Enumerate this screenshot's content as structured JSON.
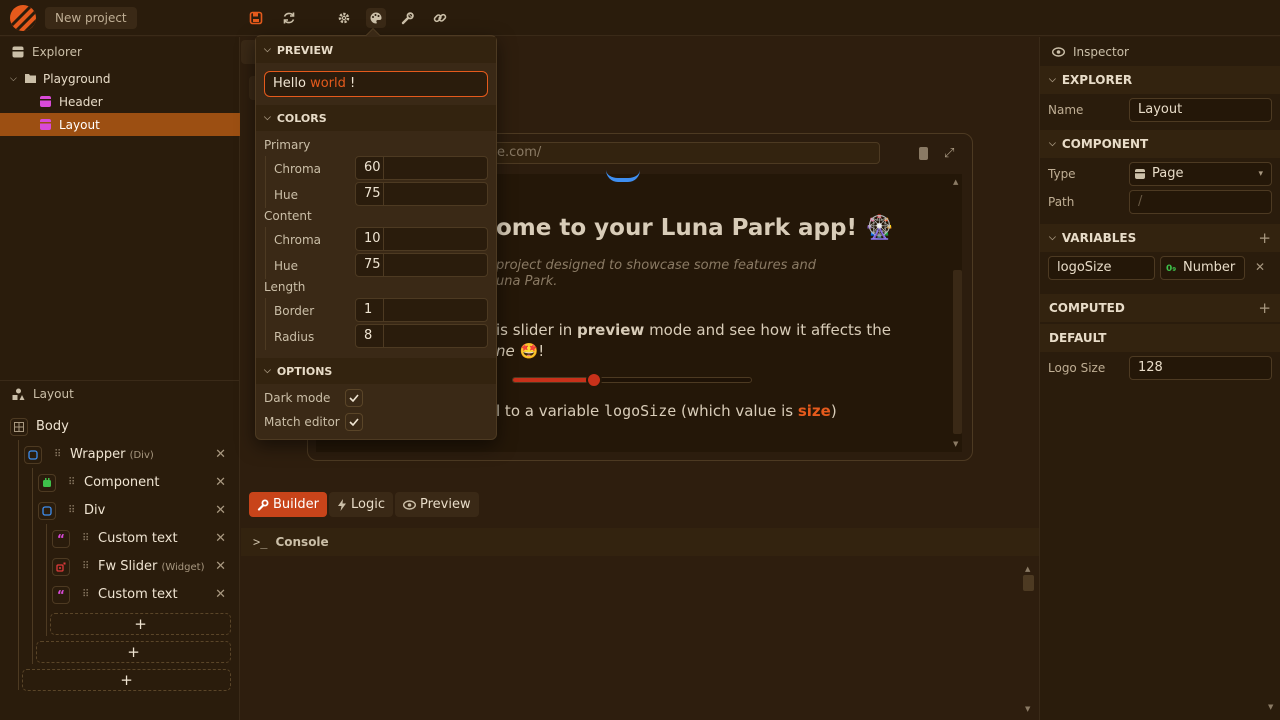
{
  "app": {
    "project_name": "New project"
  },
  "toolbar": {
    "icons": [
      "save-icon",
      "refresh-icon",
      "gear-icon",
      "palette-icon",
      "wrench-icon",
      "link-icon"
    ]
  },
  "explorer": {
    "title": "Explorer",
    "items": [
      {
        "label": "Playground"
      },
      {
        "label": "Header"
      },
      {
        "label": "Layout"
      }
    ]
  },
  "layout_panel": {
    "title": "Layout",
    "body": "Body",
    "wrapper": "Wrapper",
    "wrapper_type": "(Div)",
    "component": "Component",
    "div": "Div",
    "custom_text_1": "Custom text",
    "slider": "Fw Slider",
    "slider_type": "(Widget)",
    "custom_text_2": "Custom text",
    "add": "+"
  },
  "popup": {
    "preview_title": "PREVIEW",
    "preview_hello": "Hello ",
    "preview_world": "world",
    "preview_bang": " !",
    "colors_title": "COLORS",
    "primary_label": "Primary",
    "primary_chroma_label": "Chroma",
    "primary_chroma": "60",
    "primary_hue_label": "Hue",
    "primary_hue": "75",
    "content_label": "Content",
    "content_chroma_label": "Chroma",
    "content_chroma": "10",
    "content_hue_label": "Hue",
    "content_hue": "75",
    "length_label": "Length",
    "border_label": "Border",
    "border": "1",
    "radius_label": "Radius",
    "radius": "8",
    "options_title": "OPTIONS",
    "dark_mode": "Dark mode",
    "match_editor": "Match editor"
  },
  "preview_frame": {
    "url": "e.com/",
    "heading": "ome to your Luna Park app! 🎡",
    "sub1": "project designed to showcase some features and",
    "sub2": "una Park.",
    "p1_a": "is slider in ",
    "p1_b": "preview",
    "p1_c": " mode and see how it affects the",
    "p2_a": "ne ",
    "p2_emoji": "🤩",
    "p2_b": "!",
    "bound_a": "l to a variable ",
    "bound_code": "logoSize",
    "bound_b": " (which value is ",
    "bound_size": "size",
    "bound_c": ")",
    "slider_value": 0.34
  },
  "bottom_tabs": {
    "builder": "Builder",
    "logic": "Logic",
    "preview": "Preview"
  },
  "console": {
    "title": "Console"
  },
  "inspector": {
    "title": "Inspector",
    "explorer_section": "EXPLORER",
    "name_label": "Name",
    "name_value": "Layout",
    "component_section": "COMPONENT",
    "type_label": "Type",
    "type_value": "Page",
    "path_label": "Path",
    "path_value": "/",
    "variables_section": "VARIABLES",
    "var_name": "logoSize",
    "var_type": "Number",
    "computed_section": "COMPUTED",
    "default_section": "DEFAULT",
    "logo_size_label": "Logo Size",
    "logo_size_value": "128"
  },
  "colors": {
    "accent": "#c8441a",
    "selected": "#9c4f12",
    "bg": "#2e1e0e"
  }
}
